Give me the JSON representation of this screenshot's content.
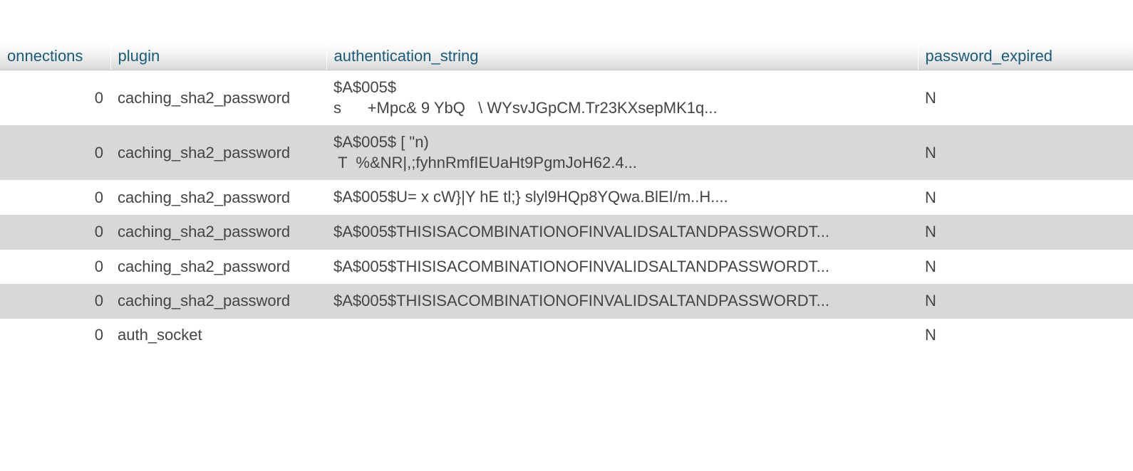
{
  "columns": {
    "connections": "onnections",
    "plugin": "plugin",
    "authentication_string": "authentication_string",
    "password_expired": "password_expired"
  },
  "rows": [
    {
      "connections": "0",
      "plugin": "caching_sha2_password",
      "authentication_string": "$A$005$\ns      +Mpc& 9 YbQ   \\ WYsvJGpCM.Tr23KXsepMK1q...",
      "password_expired": "N"
    },
    {
      "connections": "0",
      "plugin": "caching_sha2_password",
      "authentication_string": "$A$005$ [ \"n)\n T  %&NR|,;fyhnRmfIEUaHt9PgmJoH62.4...",
      "password_expired": "N"
    },
    {
      "connections": "0",
      "plugin": "caching_sha2_password",
      "authentication_string": "$A$005$U= x cW}|Y hE tl;} slyl9HQp8YQwa.BlEI/m..H....",
      "password_expired": "N"
    },
    {
      "connections": "0",
      "plugin": "caching_sha2_password",
      "authentication_string": "$A$005$THISISACOMBINATIONOFINVALIDSALTANDPASSWORDT...",
      "password_expired": "N"
    },
    {
      "connections": "0",
      "plugin": "caching_sha2_password",
      "authentication_string": "$A$005$THISISACOMBINATIONOFINVALIDSALTANDPASSWORDT...",
      "password_expired": "N"
    },
    {
      "connections": "0",
      "plugin": "caching_sha2_password",
      "authentication_string": "$A$005$THISISACOMBINATIONOFINVALIDSALTANDPASSWORDT...",
      "password_expired": "N"
    },
    {
      "connections": "0",
      "plugin": "auth_socket",
      "authentication_string": "",
      "password_expired": "N"
    }
  ]
}
